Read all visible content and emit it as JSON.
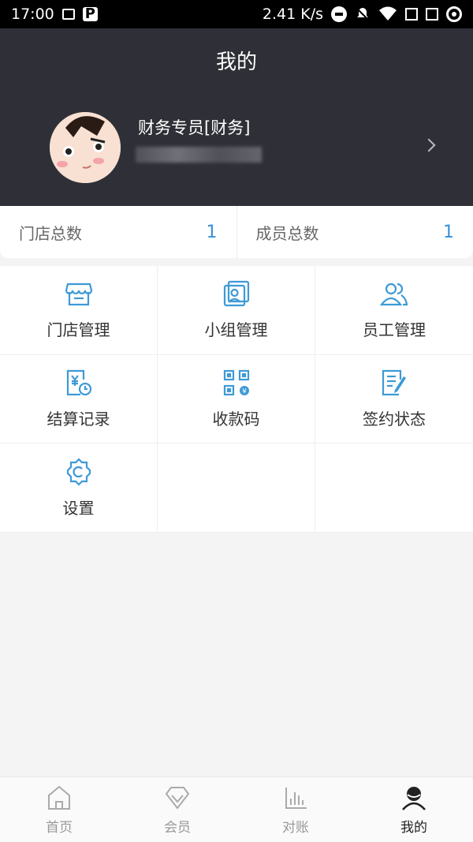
{
  "status_bar": {
    "time": "17:00",
    "speed": "2.41 K/s"
  },
  "header": {
    "title": "我的",
    "profile_name": "财务专员[财务]"
  },
  "stats": [
    {
      "label": "门店总数",
      "value": "1"
    },
    {
      "label": "成员总数",
      "value": "1"
    }
  ],
  "menu": [
    {
      "label": "门店管理",
      "icon": "store-icon"
    },
    {
      "label": "小组管理",
      "icon": "group-icon"
    },
    {
      "label": "员工管理",
      "icon": "staff-icon"
    },
    {
      "label": "结算记录",
      "icon": "settlement-icon"
    },
    {
      "label": "收款码",
      "icon": "qr-code-icon"
    },
    {
      "label": "签约状态",
      "icon": "contract-icon"
    },
    {
      "label": "设置",
      "icon": "settings-icon"
    }
  ],
  "tabbar": [
    {
      "label": "首页",
      "icon": "home-icon"
    },
    {
      "label": "会员",
      "icon": "diamond-icon"
    },
    {
      "label": "对账",
      "icon": "bar-chart-icon"
    },
    {
      "label": "我的",
      "icon": "user-icon"
    }
  ],
  "colors": {
    "header_bg": "#2f3037",
    "accent": "#3a8fd6",
    "icon_blue": "#3d9ad6"
  }
}
